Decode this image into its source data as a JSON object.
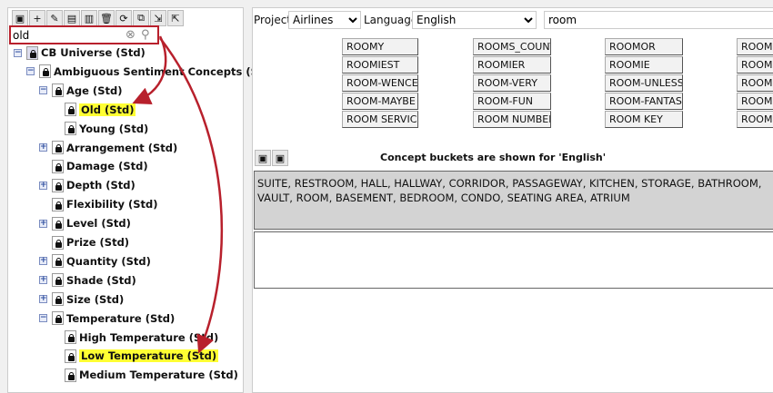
{
  "toolbar": {
    "icons": [
      "save-icon",
      "add-icon",
      "edit-icon",
      "copy-icon",
      "paste-icon",
      "delete-icon",
      "refresh-icon",
      "hierarchy-icon",
      "import-icon",
      "export-icon"
    ]
  },
  "search": {
    "value": "old"
  },
  "tree": [
    {
      "label": "CB Universe (Std)",
      "level": 0,
      "expander": "collapse",
      "icon": "folder-icon"
    },
    {
      "label": "Ambiguous Sentiment Concepts (Std)",
      "level": 1,
      "expander": "collapse"
    },
    {
      "label": "Age (Std)",
      "level": 2,
      "expander": "collapse"
    },
    {
      "label": "Old (Std)",
      "level": 3,
      "highlighted": true
    },
    {
      "label": "Young (Std)",
      "level": 3
    },
    {
      "label": "Arrangement (Std)",
      "level": 2,
      "expander": "expand"
    },
    {
      "label": "Damage (Std)",
      "level": 2
    },
    {
      "label": "Depth (Std)",
      "level": 2,
      "expander": "expand"
    },
    {
      "label": "Flexibility (Std)",
      "level": 2
    },
    {
      "label": "Level (Std)",
      "level": 2,
      "expander": "expand"
    },
    {
      "label": "Prize (Std)",
      "level": 2
    },
    {
      "label": "Quantity (Std)",
      "level": 2,
      "expander": "expand"
    },
    {
      "label": "Shade (Std)",
      "level": 2,
      "expander": "expand"
    },
    {
      "label": "Size (Std)",
      "level": 2,
      "expander": "expand"
    },
    {
      "label": "Temperature (Std)",
      "level": 2,
      "expander": "collapse"
    },
    {
      "label": "High Temperature (Std)",
      "level": 3
    },
    {
      "label": "Low Temperature (Std)",
      "level": 3,
      "highlighted": true
    },
    {
      "label": "Medium Temperature (Std)",
      "level": 3
    }
  ],
  "filters": {
    "project_label": "Project:",
    "project_value": "Airlines",
    "language_label": "Language:",
    "language_value": "English",
    "query": "room"
  },
  "words": [
    [
      "ROOMY",
      "ROOMIEST",
      "ROOM-WENCE",
      "ROOM-MAYBE",
      "ROOM SERVICE"
    ],
    [
      "ROOMS_COUNT",
      "ROOMIER",
      "ROOM-VERY",
      "ROOM-FUN",
      "ROOM NUMBER"
    ],
    [
      "ROOMOR",
      "ROOMIE",
      "ROOM-UNLESS",
      "ROOM-FANTAS..",
      "ROOM KEY"
    ],
    [
      "ROOMO",
      "ROOME",
      "ROOM-",
      "ROOM-",
      "ROOM"
    ]
  ],
  "caption": "Concept buckets are shown for 'English'",
  "bucket_text": "SUITE, RESTROOM, HALL, HALLWAY, CORRIDOR, PASSAGEWAY, KITCHEN, STORAGE, BATHROOM, VAULT, ROOM, BASEMENT, BEDROOM, CONDO, SEATING AREA, ATRIUM",
  "colors": {
    "highlight": "#ffff33",
    "annotation": "#b8202c",
    "bucket_bg": "#d3d3d3"
  }
}
